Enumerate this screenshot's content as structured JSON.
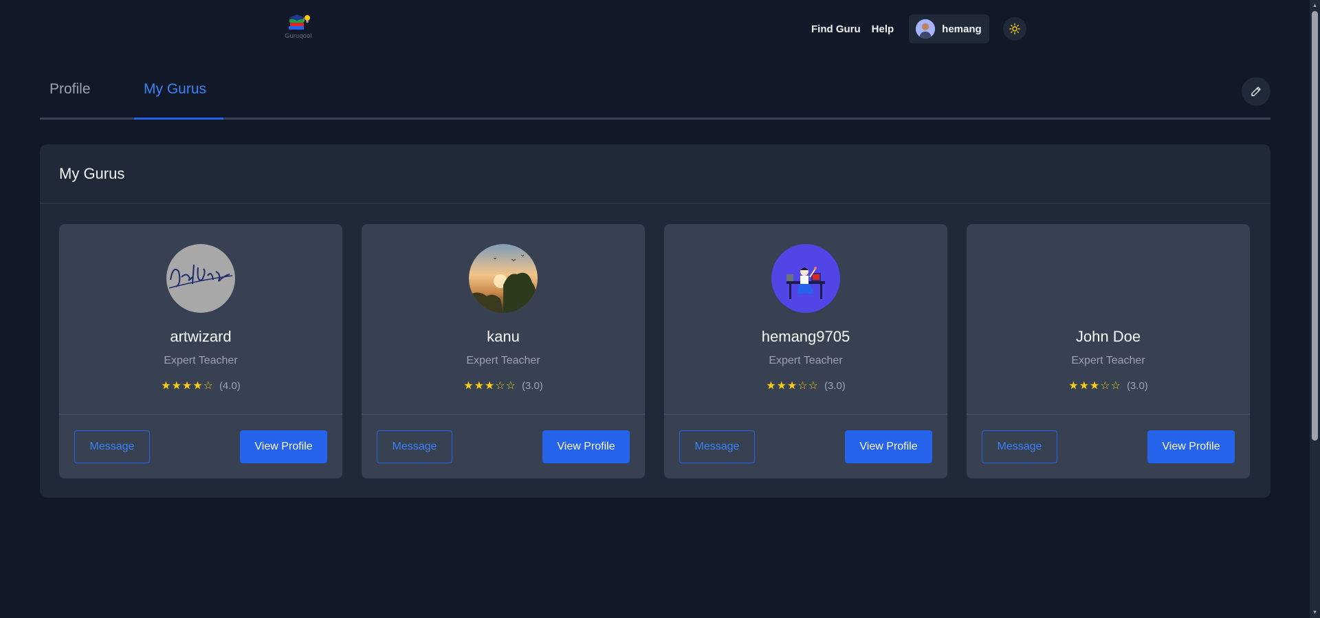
{
  "app": {
    "logo_text": "Guruqool"
  },
  "nav": {
    "links": [
      "Find Guru",
      "Help"
    ],
    "user": {
      "name": "hemang"
    },
    "theme_icon": "sun-icon"
  },
  "tabs": [
    {
      "label": "Profile",
      "active": false
    },
    {
      "label": "My Gurus",
      "active": true
    }
  ],
  "edit_icon": "pencil-icon",
  "panel": {
    "title": "My Gurus"
  },
  "gurus": [
    {
      "name": "artwizard",
      "role": "Expert Teacher",
      "stars": "★★★★☆",
      "rating": "(4.0)",
      "rating_value": 4.0,
      "message_label": "Message",
      "view_label": "View Profile"
    },
    {
      "name": "kanu",
      "role": "Expert Teacher",
      "stars": "★★★☆☆",
      "rating": "(3.0)",
      "rating_value": 3.0,
      "message_label": "Message",
      "view_label": "View Profile"
    },
    {
      "name": "hemang9705",
      "role": "Expert Teacher",
      "stars": "★★★☆☆",
      "rating": "(3.0)",
      "rating_value": 3.0,
      "message_label": "Message",
      "view_label": "View Profile"
    },
    {
      "name": "John Doe",
      "role": "Expert Teacher",
      "stars": "★★★☆☆",
      "rating": "(3.0)",
      "rating_value": 3.0,
      "message_label": "Message",
      "view_label": "View Profile"
    }
  ],
  "colors": {
    "accent": "#2563eb",
    "background": "#111827",
    "card": "#374151",
    "star": "#facc15"
  }
}
